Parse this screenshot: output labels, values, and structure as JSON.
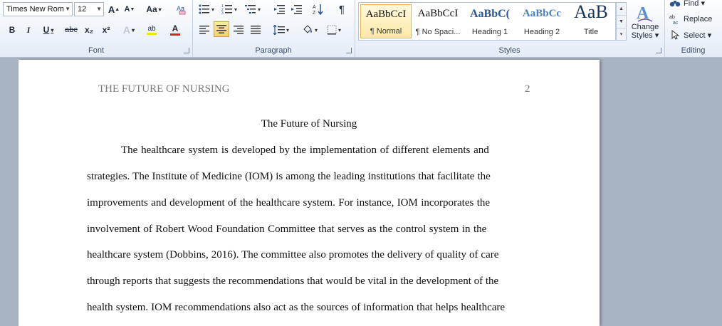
{
  "ribbon": {
    "font": {
      "label": "Font",
      "font_name": "Times New Rom",
      "font_size": "12",
      "grow": "A",
      "shrink": "A",
      "change_case": "Aa",
      "bold": "B",
      "italic": "I",
      "underline": "U",
      "strikethrough": "abc",
      "subscript": "x₂",
      "superscript": "x²",
      "text_effects": "A",
      "highlight": "ab",
      "font_color": "A"
    },
    "paragraph": {
      "label": "Paragraph",
      "show_marks": "¶"
    },
    "styles": {
      "label": "Styles",
      "items": [
        {
          "sample": "AaBbCcI",
          "name": "¶ Normal"
        },
        {
          "sample": "AaBbCcI",
          "name": "¶ No Spaci..."
        },
        {
          "sample": "AaBbC(",
          "name": "Heading 1"
        },
        {
          "sample": "AaBbCc",
          "name": "Heading 2"
        },
        {
          "sample": "AaB",
          "name": "Title"
        }
      ],
      "change_styles_line1": "Change",
      "change_styles_line2": "Styles ▾"
    },
    "editing": {
      "label": "Editing",
      "find": "Find ▾",
      "replace": "Replace",
      "select": "Select ▾"
    }
  },
  "colors": {
    "highlight": "#f2e300",
    "font_color": "#e02020",
    "accent": "#2b5797"
  },
  "document": {
    "header_title": "THE FUTURE OF NURSING",
    "page_number": "2",
    "title": "The Future of Nursing",
    "lines": [
      "The healthcare system is developed by the implementation of different elements and",
      "strategies. The Institute of Medicine (IOM) is among the leading institutions that facilitate the",
      "improvements and development of the healthcare system. For instance, IOM incorporates the",
      "involvement of Robert Wood Foundation Committee that serves as the control system in the",
      "healthcare system (Dobbins, 2016). The committee also promotes the delivery of quality of care",
      "through reports that suggests the recommendations that would be vital in the development of the",
      "health system. IOM recommendations also act as the sources of information that helps healthcare"
    ]
  }
}
